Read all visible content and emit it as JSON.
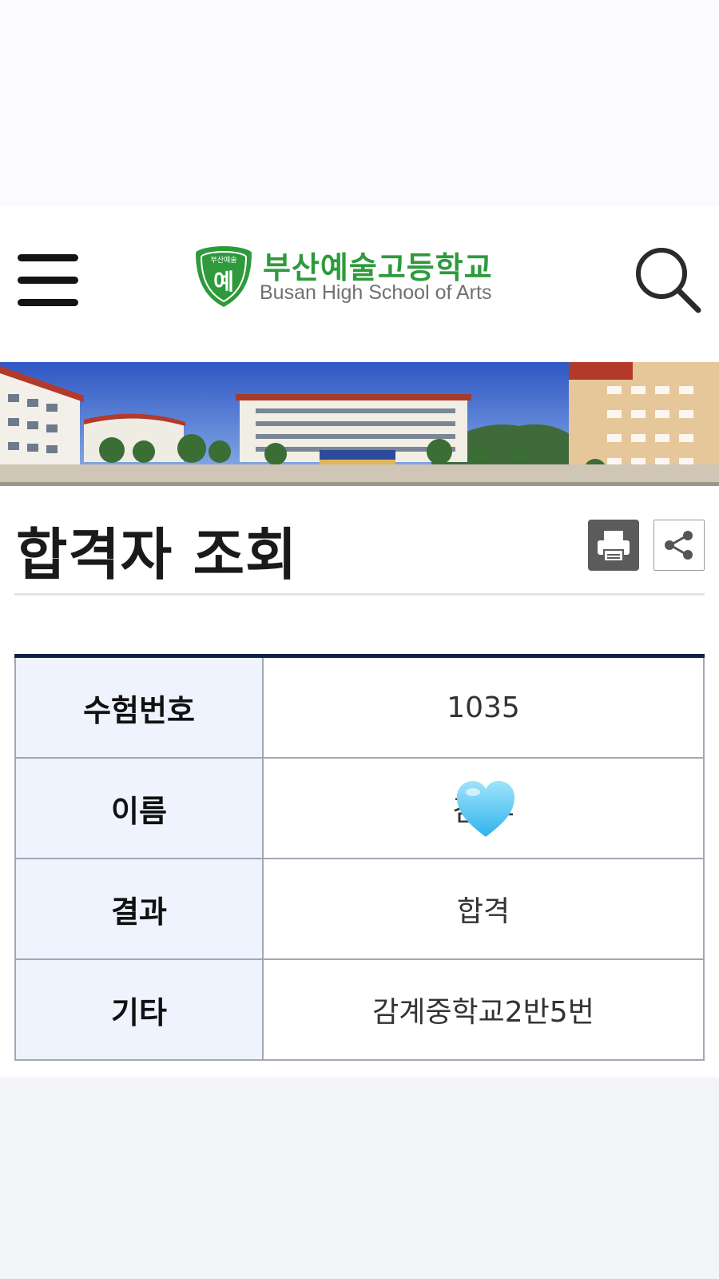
{
  "header": {
    "logo_kr": "부산예술고등학교",
    "logo_en": "Busan High School of Arts",
    "emblem_char": "예",
    "emblem_top": "부산예술",
    "menu_icon": "hamburger-menu-icon",
    "search_icon": "magnifier-icon",
    "brand_color": "#2e9a3c"
  },
  "page": {
    "title": "합격자 조회",
    "print_icon": "printer-icon",
    "share_icon": "share-icon"
  },
  "result": {
    "rows": [
      {
        "label": "수험번호",
        "value": "1035"
      },
      {
        "label": "이름",
        "value": "김 후"
      },
      {
        "label": "결과",
        "value": "합격"
      },
      {
        "label": "기타",
        "value": "감계중학교2반5번"
      }
    ]
  },
  "overlay": {
    "emoji": "light-blue-heart-emoji"
  }
}
